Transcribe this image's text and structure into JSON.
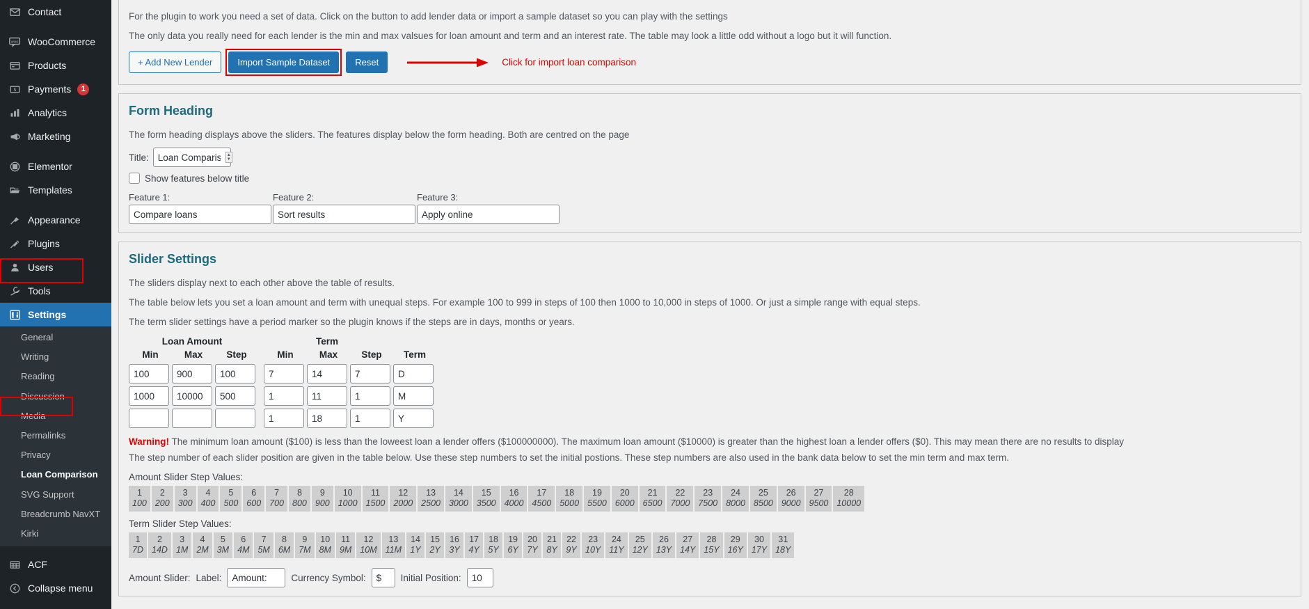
{
  "sidebar": {
    "items": [
      {
        "label": "Contact",
        "icon": "envelope-icon",
        "badge": null
      },
      {
        "label": "WooCommerce",
        "icon": "woo-icon",
        "badge": null
      },
      {
        "label": "Products",
        "icon": "products-icon",
        "badge": null
      },
      {
        "label": "Payments",
        "icon": "payments-icon",
        "badge": "1"
      },
      {
        "label": "Analytics",
        "icon": "analytics-icon",
        "badge": null
      },
      {
        "label": "Marketing",
        "icon": "megaphone-icon",
        "badge": null
      },
      {
        "label": "Elementor",
        "icon": "elementor-icon",
        "badge": null
      },
      {
        "label": "Templates",
        "icon": "folder-icon",
        "badge": null
      },
      {
        "label": "Appearance",
        "icon": "paintbrush-icon",
        "badge": null
      },
      {
        "label": "Plugins",
        "icon": "plug-icon",
        "badge": null
      },
      {
        "label": "Users",
        "icon": "user-icon",
        "badge": null
      },
      {
        "label": "Tools",
        "icon": "wrench-icon",
        "badge": null
      },
      {
        "label": "Settings",
        "icon": "sliders-icon",
        "badge": null
      }
    ],
    "settings_submenu": [
      "General",
      "Writing",
      "Reading",
      "Discussion",
      "Media",
      "Permalinks",
      "Privacy",
      "Loan Comparison",
      "SVG Support",
      "Breadcrumb NavXT",
      "Kirki"
    ],
    "current_submenu": "Loan Comparison",
    "acf": {
      "label": "ACF",
      "icon": "acf-icon"
    },
    "collapse": {
      "label": "Collapse menu",
      "icon": "collapse-icon"
    },
    "highlight_color": "#e00000",
    "active_color": "#2271b1"
  },
  "intro": {
    "line1": "For the plugin to work you need a set of data. Click on the button to add lender data or import a sample dataset so you can play with the settings",
    "line2": "The only data you really need for each lender is the min and max valsues for loan amount and term and an interest rate. The table may look a little odd without a logo but it will function.",
    "buttons": {
      "add_lender": "+ Add New Lender",
      "import_sample": "Import Sample Dataset",
      "reset": "Reset"
    },
    "annotation": "Click for import loan comparison"
  },
  "form_heading": {
    "title": "Form Heading",
    "description": "The form heading displays above the sliders. The features display below the form heading. Both are centred on the page",
    "title_label": "Title:",
    "title_value": "Loan Comparisons",
    "checkbox_label": "Show features below title",
    "checkbox_checked": false,
    "features": [
      {
        "label": "Feature 1:",
        "value": "Compare loans"
      },
      {
        "label": "Feature 2:",
        "value": "Sort results"
      },
      {
        "label": "Feature 3:",
        "value": "Apply online"
      }
    ]
  },
  "slider_settings": {
    "title": "Slider Settings",
    "p1": "The sliders display next to each other above the table of results.",
    "p2": "The table below lets you set a loan amount and term with unequal steps. For example 100 to 999 in steps of 100 then 1000 to 10,000 in steps of 1000. Or just a simple range with equal steps.",
    "p3": "The term slider settings have a period marker so the plugin knows if the steps are in days, months or years.",
    "group_headers": {
      "loan_amount": "Loan Amount",
      "term": "Term"
    },
    "col_headers": [
      "Min",
      "Max",
      "Step",
      "Min",
      "Max",
      "Step",
      "Term"
    ],
    "rows": [
      {
        "amount_min": "100",
        "amount_max": "900",
        "amount_step": "100",
        "term_min": "7",
        "term_max": "14",
        "term_step": "7",
        "term_period": "D"
      },
      {
        "amount_min": "1000",
        "amount_max": "10000",
        "amount_step": "500",
        "term_min": "1",
        "term_max": "11",
        "term_step": "1",
        "term_period": "M"
      },
      {
        "amount_min": "",
        "amount_max": "",
        "amount_step": "",
        "term_min": "1",
        "term_max": "18",
        "term_step": "1",
        "term_period": "Y"
      }
    ],
    "warning_prefix": "Warning!",
    "warning_text": " The minimum loan amount ($100) is less than the loweest loan a lender offers ($100000000). The maximum loan amount ($10000) is greater than the highest loan a lender offers ($0). This may mean there are no results to display",
    "step_note": "The step number of each slider position are given in the table below. Use these step numbers to set the initial postions. These step numbers are also used in the bank data below to set the min term and max term.",
    "amount_steps_label": "Amount Slider Step Values:",
    "amount_steps": [
      {
        "n": "1",
        "v": "100"
      },
      {
        "n": "2",
        "v": "200"
      },
      {
        "n": "3",
        "v": "300"
      },
      {
        "n": "4",
        "v": "400"
      },
      {
        "n": "5",
        "v": "500"
      },
      {
        "n": "6",
        "v": "600"
      },
      {
        "n": "7",
        "v": "700"
      },
      {
        "n": "8",
        "v": "800"
      },
      {
        "n": "9",
        "v": "900"
      },
      {
        "n": "10",
        "v": "1000"
      },
      {
        "n": "11",
        "v": "1500"
      },
      {
        "n": "12",
        "v": "2000"
      },
      {
        "n": "13",
        "v": "2500"
      },
      {
        "n": "14",
        "v": "3000"
      },
      {
        "n": "15",
        "v": "3500"
      },
      {
        "n": "16",
        "v": "4000"
      },
      {
        "n": "17",
        "v": "4500"
      },
      {
        "n": "18",
        "v": "5000"
      },
      {
        "n": "19",
        "v": "5500"
      },
      {
        "n": "20",
        "v": "6000"
      },
      {
        "n": "21",
        "v": "6500"
      },
      {
        "n": "22",
        "v": "7000"
      },
      {
        "n": "23",
        "v": "7500"
      },
      {
        "n": "24",
        "v": "8000"
      },
      {
        "n": "25",
        "v": "8500"
      },
      {
        "n": "26",
        "v": "9000"
      },
      {
        "n": "27",
        "v": "9500"
      },
      {
        "n": "28",
        "v": "10000"
      }
    ],
    "term_steps_label": "Term Slider Step Values:",
    "term_steps": [
      {
        "n": "1",
        "v": "7D"
      },
      {
        "n": "2",
        "v": "14D"
      },
      {
        "n": "3",
        "v": "1M"
      },
      {
        "n": "4",
        "v": "2M"
      },
      {
        "n": "5",
        "v": "3M"
      },
      {
        "n": "6",
        "v": "4M"
      },
      {
        "n": "7",
        "v": "5M"
      },
      {
        "n": "8",
        "v": "6M"
      },
      {
        "n": "9",
        "v": "7M"
      },
      {
        "n": "10",
        "v": "8M"
      },
      {
        "n": "11",
        "v": "9M"
      },
      {
        "n": "12",
        "v": "10M"
      },
      {
        "n": "13",
        "v": "11M"
      },
      {
        "n": "14",
        "v": "1Y"
      },
      {
        "n": "15",
        "v": "2Y"
      },
      {
        "n": "16",
        "v": "3Y"
      },
      {
        "n": "17",
        "v": "4Y"
      },
      {
        "n": "18",
        "v": "5Y"
      },
      {
        "n": "19",
        "v": "6Y"
      },
      {
        "n": "20",
        "v": "7Y"
      },
      {
        "n": "21",
        "v": "8Y"
      },
      {
        "n": "22",
        "v": "9Y"
      },
      {
        "n": "23",
        "v": "10Y"
      },
      {
        "n": "24",
        "v": "11Y"
      },
      {
        "n": "25",
        "v": "12Y"
      },
      {
        "n": "26",
        "v": "13Y"
      },
      {
        "n": "27",
        "v": "14Y"
      },
      {
        "n": "28",
        "v": "15Y"
      },
      {
        "n": "29",
        "v": "16Y"
      },
      {
        "n": "30",
        "v": "17Y"
      },
      {
        "n": "31",
        "v": "18Y"
      }
    ],
    "amount_slider": {
      "prefix": "Amount Slider:",
      "label_label": "Label:",
      "label_value": "Amount:",
      "currency_label": "Currency Symbol:",
      "currency_value": "$",
      "position_label": "Initial Position:",
      "position_value": "10"
    }
  }
}
